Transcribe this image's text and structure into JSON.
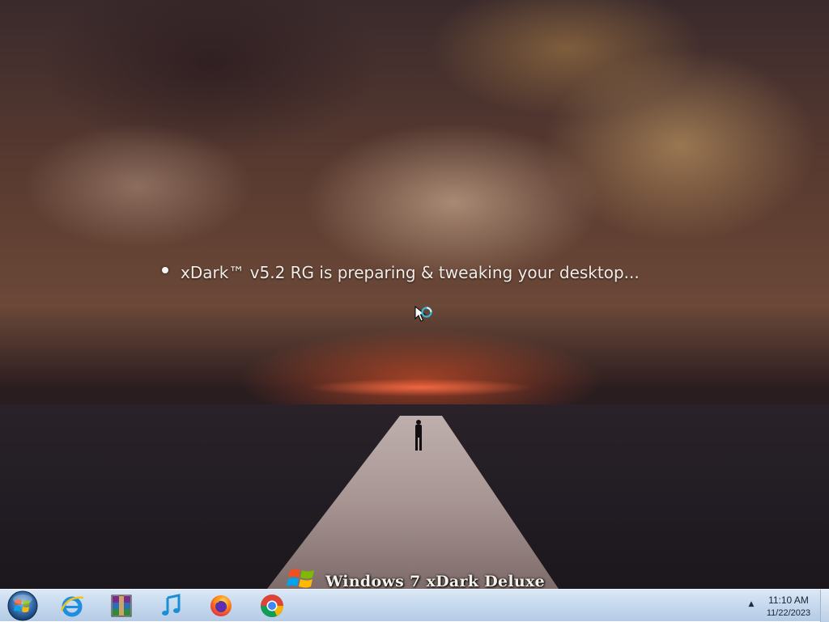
{
  "desktop": {
    "loading_message": "xDark™ v5.2 RG is preparing & tweaking your desktop...",
    "branding_text": "Windows 7 xDark Deluxe"
  },
  "taskbar": {
    "start_icon": "windows-start-orb",
    "pinned": [
      {
        "name": "Internet Explorer",
        "icon": "internet-explorer-icon"
      },
      {
        "name": "WinRAR",
        "icon": "winrar-icon"
      },
      {
        "name": "Music",
        "icon": "music-note-icon"
      },
      {
        "name": "Firefox",
        "icon": "firefox-icon"
      },
      {
        "name": "Google Chrome",
        "icon": "chrome-icon"
      }
    ],
    "tray": {
      "expand_icon": "▲",
      "time": "11:10 AM",
      "date": "11/22/2023"
    }
  },
  "colors": {
    "taskbar_top": "#dbe8f6",
    "taskbar_bottom": "#b5cbe5",
    "text_light": "#f2ece6"
  }
}
